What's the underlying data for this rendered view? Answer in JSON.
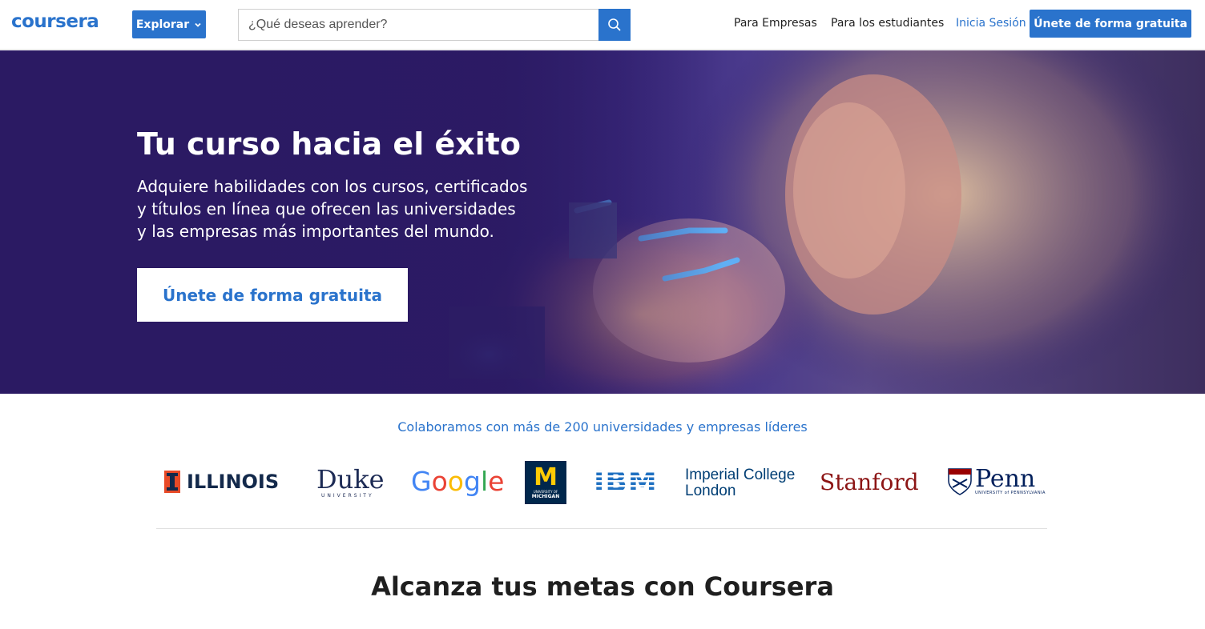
{
  "header": {
    "logo": "coursera",
    "explore_label": "Explorar",
    "search_placeholder": "¿Qué deseas aprender?",
    "nav": {
      "business": "Para Empresas",
      "students": "Para los estudiantes",
      "login": "Inicia Sesión",
      "join": "Únete de forma gratuita"
    }
  },
  "hero": {
    "title": "Tu curso hacia el éxito",
    "subtitle": "Adquiere habilidades con los cursos, certificados y títulos en línea que ofrecen las universidades y las empresas más importantes del mundo.",
    "cta": "Únete de forma gratuita"
  },
  "partners": {
    "heading": "Colaboramos con más de 200 universidades y empresas líderes",
    "logos": {
      "illinois": "ILLINOIS",
      "duke": "Duke",
      "duke_sub": "UNIVERSITY",
      "google": [
        "G",
        "o",
        "o",
        "g",
        "l",
        "e"
      ],
      "michigan": "M",
      "michigan_sub1": "UNIVERSITY OF",
      "michigan_sub2": "MICHIGAN",
      "ibm": "IBM",
      "imperial_line1": "Imperial College",
      "imperial_line2": "London",
      "stanford": "Stanford",
      "penn": "Penn",
      "penn_sub": "UNIVERSITY of PENNSYLVANIA"
    }
  },
  "section": {
    "title": "Alcanza tus metas con Coursera"
  },
  "colors": {
    "brand_blue": "#2a73cc",
    "hero_purple": "#2b1a63",
    "google_blue": "#4285f4",
    "google_red": "#ea4335",
    "google_yellow": "#fbbc05",
    "google_green": "#34a853",
    "illinois_orange": "#e84a27",
    "illinois_navy": "#13294b",
    "michigan_blue": "#00274c",
    "michigan_maize": "#ffcb05",
    "stanford_red": "#8c1515",
    "penn_blue": "#011f5b",
    "imperial_blue": "#003e74",
    "ibm_blue": "#1f70c1"
  }
}
